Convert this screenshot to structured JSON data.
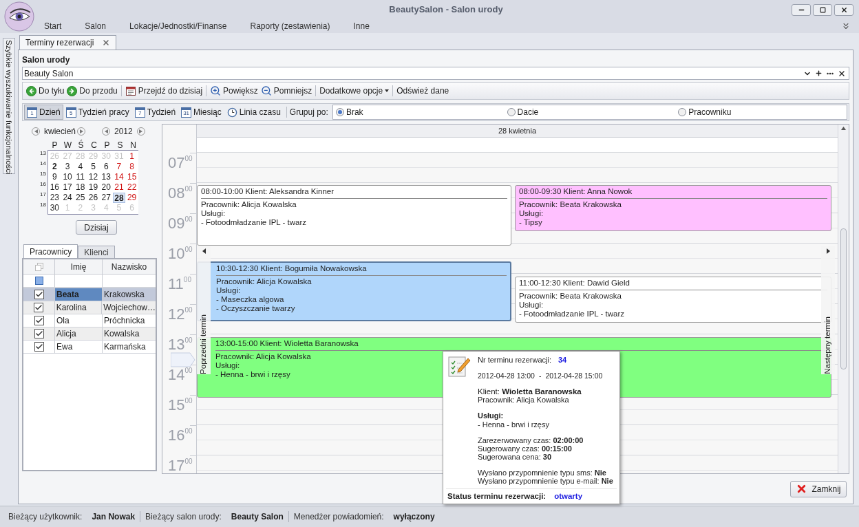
{
  "window": {
    "title": "BeautySalon - Salon urody"
  },
  "menu": [
    "Start",
    "Salon",
    "Lokacje/Jednostki/Finanse",
    "Raporty (zestawienia)",
    "Inne"
  ],
  "side_panel": {
    "label": "Szybkie wyszukiwanie funkcjonalności"
  },
  "document_tabs": [
    {
      "label": "Terminy rezerwacji",
      "selected": true
    }
  ],
  "salon": {
    "label": "Salon urody",
    "value": "Beauty Salon"
  },
  "toolbar": [
    {
      "label": "Do tyłu",
      "kind": "back"
    },
    {
      "label": "Do przodu",
      "kind": "forward"
    },
    {
      "label": "Przejdź do dzisiaj",
      "kind": "today"
    },
    {
      "label": "Powiększ",
      "kind": "zoom-in"
    },
    {
      "label": "Pomniejsz",
      "kind": "zoom-out"
    },
    {
      "label": "Dodatkowe opcje",
      "kind": "menu"
    },
    {
      "label": "Odśwież dane",
      "kind": "refresh"
    }
  ],
  "views": [
    {
      "label": "Dzień",
      "icon_text": "1",
      "kind": "calendar",
      "selected": true
    },
    {
      "label": "Tydzień pracy",
      "icon_text": "5",
      "kind": "calendar",
      "selected": false
    },
    {
      "label": "Tydzień",
      "icon_text": "7",
      "kind": "calendar",
      "selected": false
    },
    {
      "label": "Miesiąc",
      "icon_text": "31",
      "kind": "calendar",
      "selected": false
    },
    {
      "label": "Linia czasu",
      "kind": "clock",
      "selected": false
    }
  ],
  "group_by": {
    "label": "Grupuj po:",
    "options": [
      {
        "label": "Brak",
        "selected": true
      },
      {
        "label": "Dacie",
        "selected": false
      },
      {
        "label": "Pracowniku",
        "selected": false
      }
    ]
  },
  "mini_calendar": {
    "month": "kwiecień",
    "year": "2012",
    "weekdays": [
      "P",
      "W",
      "Ś",
      "C",
      "P",
      "S",
      "N"
    ],
    "weeks": [
      {
        "number": "13",
        "days": [
          {
            "text": "26",
            "kind": "outside"
          },
          {
            "text": "27",
            "kind": "outside"
          },
          {
            "text": "28",
            "kind": "outside"
          },
          {
            "text": "29",
            "kind": "outside"
          },
          {
            "text": "30",
            "kind": "outside"
          },
          {
            "text": "31",
            "kind": "outside"
          },
          {
            "text": "1",
            "kind": "weekend"
          }
        ]
      },
      {
        "number": "14",
        "days": [
          {
            "text": "2",
            "kind": "busy"
          },
          {
            "text": "3",
            "kind": "day"
          },
          {
            "text": "4",
            "kind": "day"
          },
          {
            "text": "5",
            "kind": "day"
          },
          {
            "text": "6",
            "kind": "day"
          },
          {
            "text": "7",
            "kind": "weekend"
          },
          {
            "text": "8",
            "kind": "weekend"
          }
        ]
      },
      {
        "number": "15",
        "days": [
          {
            "text": "9",
            "kind": "day"
          },
          {
            "text": "10",
            "kind": "day"
          },
          {
            "text": "11",
            "kind": "day"
          },
          {
            "text": "12",
            "kind": "day"
          },
          {
            "text": "13",
            "kind": "day"
          },
          {
            "text": "14",
            "kind": "weekend"
          },
          {
            "text": "15",
            "kind": "weekend"
          }
        ]
      },
      {
        "number": "16",
        "days": [
          {
            "text": "16",
            "kind": "day"
          },
          {
            "text": "17",
            "kind": "day"
          },
          {
            "text": "18",
            "kind": "day"
          },
          {
            "text": "19",
            "kind": "day"
          },
          {
            "text": "20",
            "kind": "day"
          },
          {
            "text": "21",
            "kind": "weekend"
          },
          {
            "text": "22",
            "kind": "weekend"
          }
        ]
      },
      {
        "number": "17",
        "days": [
          {
            "text": "23",
            "kind": "day"
          },
          {
            "text": "24",
            "kind": "day"
          },
          {
            "text": "25",
            "kind": "day"
          },
          {
            "text": "26",
            "kind": "day"
          },
          {
            "text": "27",
            "kind": "day"
          },
          {
            "text": "28",
            "kind": "selected"
          },
          {
            "text": "29",
            "kind": "weekend"
          }
        ]
      },
      {
        "number": "18",
        "days": [
          {
            "text": "30",
            "kind": "day"
          },
          {
            "text": "1",
            "kind": "outside"
          },
          {
            "text": "2",
            "kind": "outside"
          },
          {
            "text": "3",
            "kind": "outside"
          },
          {
            "text": "4",
            "kind": "outside"
          },
          {
            "text": "5",
            "kind": "outside"
          },
          {
            "text": "6",
            "kind": "outside"
          }
        ]
      }
    ]
  },
  "today_button": "Dzisiaj",
  "list_tabs": [
    {
      "label": "Pracownicy",
      "selected": true
    },
    {
      "label": "Klienci",
      "selected": false
    }
  ],
  "employees": {
    "columns": [
      "Imię",
      "Nazwisko"
    ],
    "filter_indeterminate": true,
    "rows": [
      {
        "first": "Beata",
        "last": "Krakowska",
        "checked": true,
        "selected": true
      },
      {
        "first": "Karolina",
        "last": "Wojciechow…",
        "checked": true,
        "selected": false
      },
      {
        "first": "Ola",
        "last": "Próchnicka",
        "checked": true,
        "selected": false
      },
      {
        "first": "Alicja",
        "last": "Kowalska",
        "checked": true,
        "selected": false
      },
      {
        "first": "Ewa",
        "last": "Karmańska",
        "checked": true,
        "selected": false
      }
    ]
  },
  "scheduler": {
    "date": "28 kwietnia",
    "prev_label": "Poprzedni termin",
    "next_label": "Następny termin",
    "hours": [
      {
        "hour": "07",
        "minutes": "00"
      },
      {
        "hour": "08",
        "minutes": "00"
      },
      {
        "hour": "09",
        "minutes": "00"
      },
      {
        "hour": "10",
        "minutes": "00"
      },
      {
        "hour": "11",
        "minutes": "00"
      },
      {
        "hour": "12",
        "minutes": "00"
      },
      {
        "hour": "13",
        "minutes": "00"
      },
      {
        "hour": "14",
        "minutes": "00"
      },
      {
        "hour": "15",
        "minutes": "00"
      },
      {
        "hour": "16",
        "minutes": "00"
      },
      {
        "hour": "17",
        "minutes": "00"
      }
    ],
    "appointments": [
      {
        "header": "08:00-10:00 Klient: Aleksandra Kinner",
        "lines": [
          "Pracownik: Alicja Kowalska",
          "Usługi:",
          "- Fotoodmładzanie IPL - twarz"
        ],
        "color": "#ffffff",
        "selected": false
      },
      {
        "header": "08:00-09:30 Klient: Anna Nowok",
        "lines": [
          "Pracownik: Beata Krakowska",
          "Usługi:",
          "- Tipsy"
        ],
        "color": "#ffc0ff",
        "selected": false
      },
      {
        "header": "10:30-12:30 Klient: Bogumiła Nowakowska",
        "lines": [
          "Pracownik: Alicja Kowalska",
          "Usługi:",
          "- Maseczka algowa",
          "- Oczyszczanie twarzy"
        ],
        "color": "#b0d6fb",
        "selected": true
      },
      {
        "header": "11:00-12:30 Klient: Dawid Gield",
        "lines": [
          "Pracownik: Beata Krakowska",
          "Usługi:",
          "- Fotoodmładzanie IPL - twarz"
        ],
        "color": "#ffffff",
        "selected": false
      },
      {
        "header": "13:00-15:00 Klient: Wioletta Baranowska",
        "lines": [
          "Pracownik: Alicja Kowalska",
          "Usługi:",
          "- Henna - brwi i rzęsy"
        ],
        "color": "#80ff80",
        "selected": false
      }
    ]
  },
  "tooltip": {
    "number_label": "Nr terminu rezerwacji:",
    "number": "34",
    "start": "2012-04-28 13:00",
    "dash": "-",
    "end": "2012-04-28 15:00",
    "client": "Klient: **Wioletta Baranowska**",
    "employee": "Pracownik: Alicja Kowalska",
    "services_label": "Usługi:",
    "services": [
      "- Henna - brwi i rzęsy"
    ],
    "times": [
      "Zarezerwowany czas: **02:00:00**",
      "Sugerowany czas: **00:15:00**",
      "Sugerowana cena: **30**"
    ],
    "reminders": [
      "Wysłano przypomnienie typu sms: **Nie**",
      "Wysłano przypomnienie typu e-mail: **Nie**"
    ],
    "status_label": "Status terminu rezerwacji:",
    "status": "otwarty"
  },
  "close_button": "Zamknij",
  "status_bar": [
    {
      "label": "Bieżący użytkownik:",
      "value": "Jan Nowak"
    },
    {
      "label": "Bieżący salon urody:",
      "value": "Beauty Salon"
    },
    {
      "label": "Menedżer powiadomień:",
      "value": "wyłączony"
    }
  ]
}
